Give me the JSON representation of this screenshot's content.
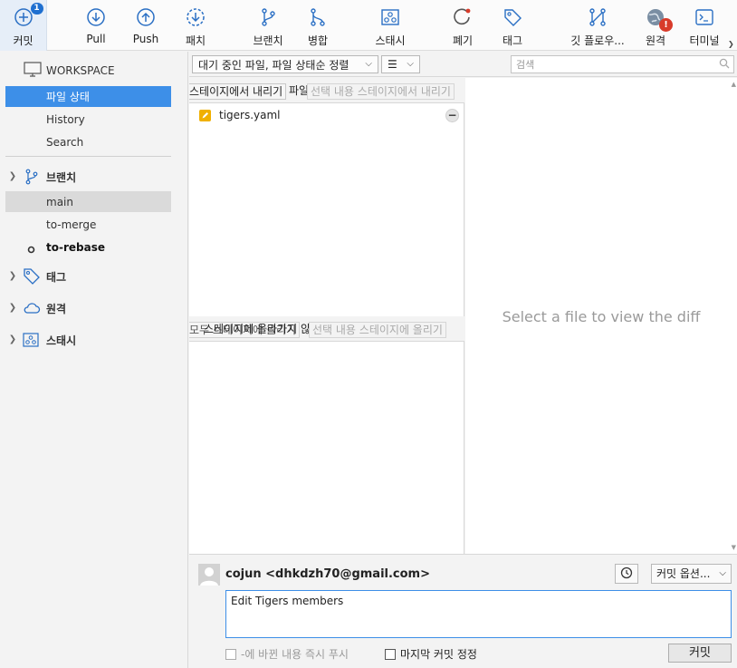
{
  "toolbar": {
    "commit": {
      "label": "커밋",
      "badge": "1"
    },
    "pull": {
      "label": "Pull"
    },
    "push": {
      "label": "Push"
    },
    "fetch": {
      "label": "패치"
    },
    "branch": {
      "label": "브랜치"
    },
    "merge": {
      "label": "병합"
    },
    "stash": {
      "label": "스태시"
    },
    "discard": {
      "label": "폐기"
    },
    "tag": {
      "label": "태그"
    },
    "gitflow": {
      "label": "깃 플로우..."
    },
    "remote": {
      "label": "원격",
      "alert": "!"
    },
    "terminal": {
      "label": "터미널"
    }
  },
  "sidebar": {
    "workspace": {
      "title": "WORKSPACE",
      "items": [
        {
          "label": "파일 상태"
        },
        {
          "label": "History"
        },
        {
          "label": "Search"
        }
      ]
    },
    "branches": {
      "title": "브랜치",
      "items": [
        {
          "label": "main"
        },
        {
          "label": "to-merge"
        },
        {
          "label": "to-rebase"
        }
      ]
    },
    "tags": {
      "title": "태그"
    },
    "remotes": {
      "title": "원격"
    },
    "stashes": {
      "title": "스태시"
    }
  },
  "filterbar": {
    "sort_select": "대기 중인 파일, 파일 상태순 정렬",
    "view_select": "☰",
    "search_placeholder": "검색"
  },
  "staged": {
    "unstage_all": "스테이지에서 내리기",
    "title_suffix": "파일",
    "unstage_selected": "선택 내용 스테이지에서 내리기",
    "files": [
      {
        "name": "tigers.yaml"
      }
    ]
  },
  "unstaged": {
    "stage_all": "모두 스테이지에 올리기",
    "title": "스테이지에 올라가지 않은 파일",
    "stage_selected": "선택 내용 스테이지에 올리기"
  },
  "diff": {
    "empty_message": "Select a file to view the diff"
  },
  "commit": {
    "author": "cojun <dhkdzh70@gmail.com>",
    "options": "커밋 옵션...",
    "message": "Edit Tigers members",
    "push_immediately": "-에 바뀐 내용 즉시 푸시",
    "amend_last": "마지막 커밋 정정",
    "commit_button": "커밋"
  },
  "colors": {
    "accent": "#3d8fe8",
    "toolbar_icon": "#2a6fc4",
    "alert": "#d83b2a",
    "modified_file": "#f0b000"
  }
}
